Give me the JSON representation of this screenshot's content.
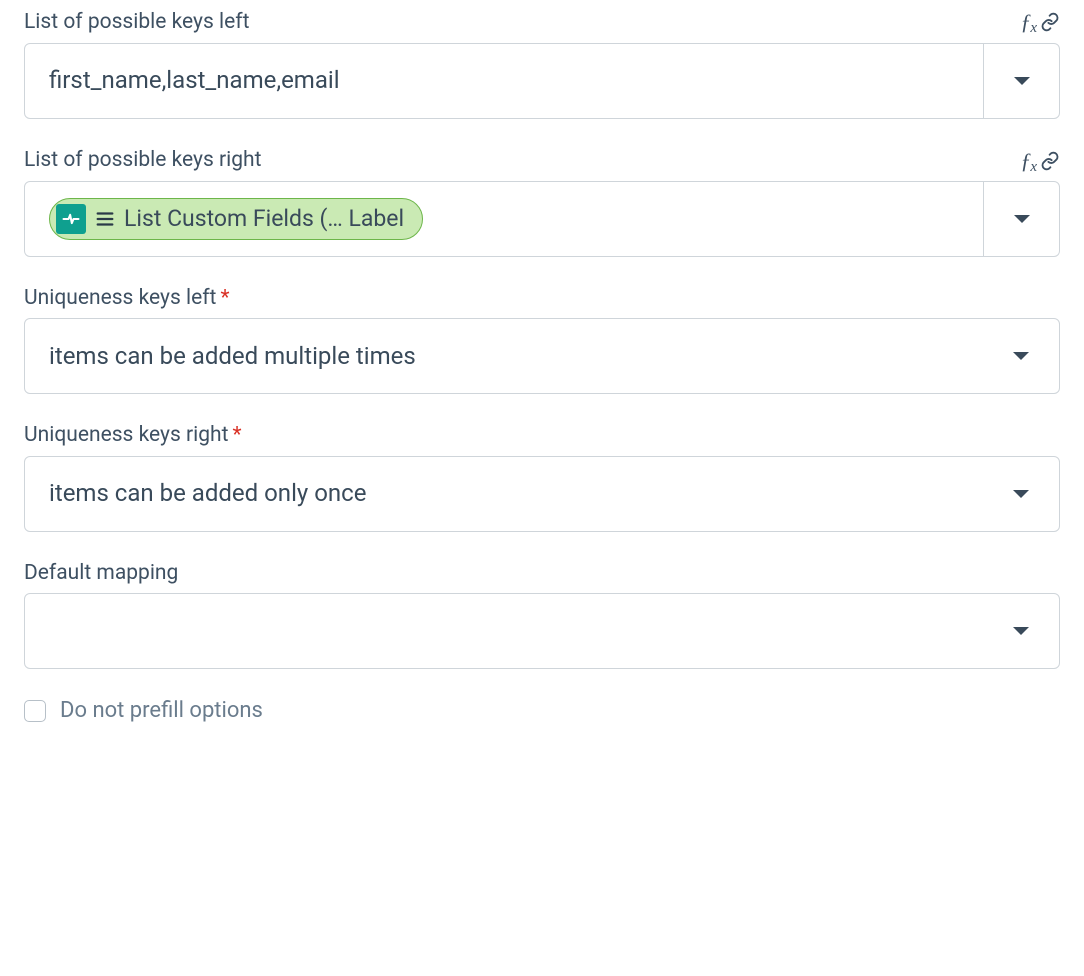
{
  "fields": {
    "possible_keys_left": {
      "label": "List of possible keys left",
      "value": "first_name,last_name,email",
      "has_fx": true
    },
    "possible_keys_right": {
      "label": "List of possible keys right",
      "pill_text": "List Custom Fields (… Label",
      "has_fx": true
    },
    "uniqueness_left": {
      "label": "Uniqueness keys left",
      "required": true,
      "value": "items can be added multiple times"
    },
    "uniqueness_right": {
      "label": "Uniqueness keys right",
      "required": true,
      "value": "items can be added only once"
    },
    "default_mapping": {
      "label": "Default mapping",
      "value": ""
    }
  },
  "checkbox": {
    "label": "Do not prefill options",
    "checked": false
  },
  "glyphs": {
    "required": "*"
  }
}
